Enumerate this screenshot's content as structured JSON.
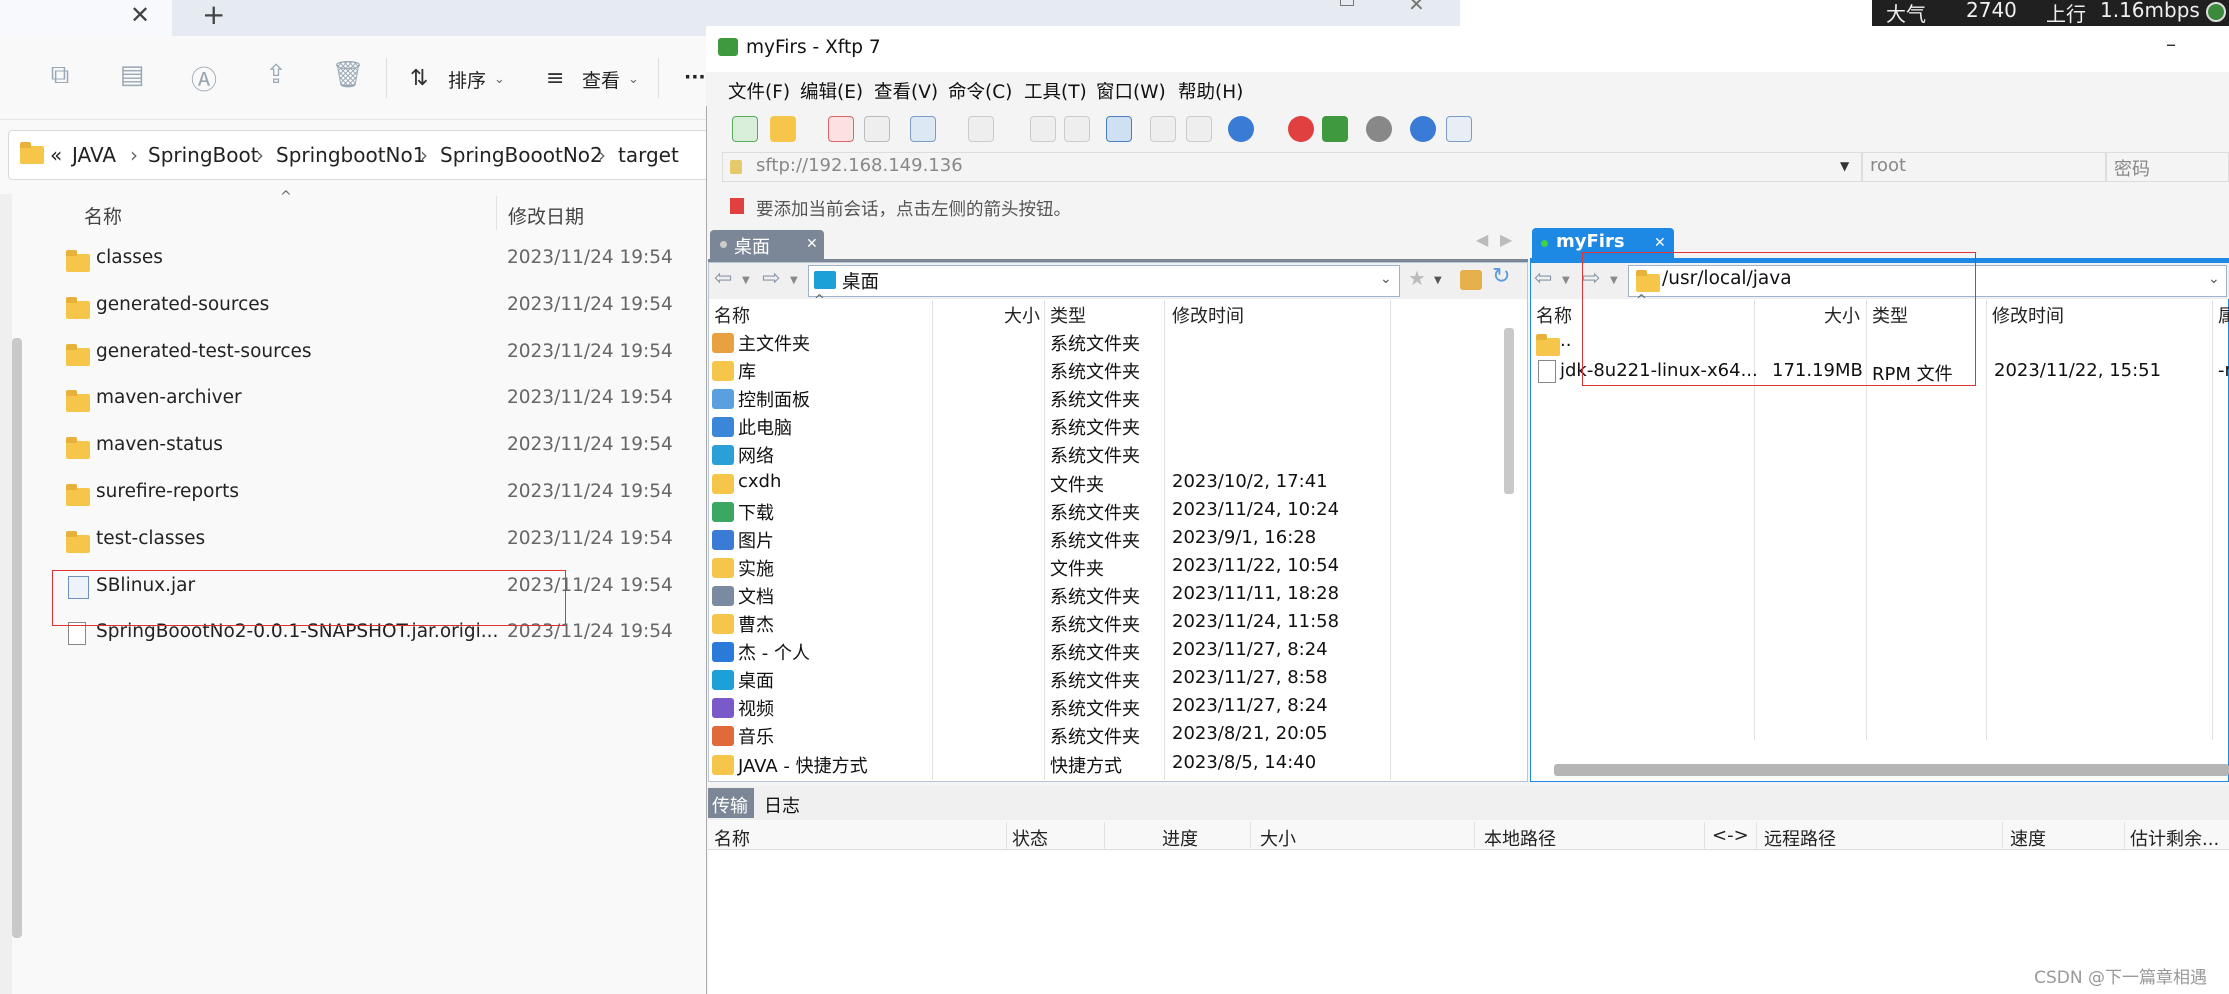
{
  "explorer": {
    "address_prefix": "«",
    "breadcrumbs": [
      "JAVA",
      "SpringBoot",
      "SpringbootNo1",
      "SpringBoootNo2",
      "target"
    ],
    "toolbar": {
      "sort_label": "排序",
      "view_label": "查看",
      "more_label": "···"
    },
    "columns": {
      "name": "名称",
      "modified": "修改日期"
    },
    "files": [
      {
        "name": "classes",
        "date": "2023/11/24 19:54",
        "icon": "folder-icon"
      },
      {
        "name": "generated-sources",
        "date": "2023/11/24 19:54",
        "icon": "folder-icon"
      },
      {
        "name": "generated-test-sources",
        "date": "2023/11/24 19:54",
        "icon": "folder-icon"
      },
      {
        "name": "maven-archiver",
        "date": "2023/11/24 19:54",
        "icon": "folder-icon"
      },
      {
        "name": "maven-status",
        "date": "2023/11/24 19:54",
        "icon": "folder-icon"
      },
      {
        "name": "surefire-reports",
        "date": "2023/11/24 19:54",
        "icon": "folder-icon"
      },
      {
        "name": "test-classes",
        "date": "2023/11/24 19:54",
        "icon": "folder-icon"
      },
      {
        "name": "SBlinux.jar",
        "date": "2023/11/24 19:54",
        "icon": "jar-icon"
      },
      {
        "name": "SpringBoootNo2-0.0.1-SNAPSHOT.jar.origi...",
        "date": "2023/11/24 19:54",
        "icon": "file-icon"
      }
    ]
  },
  "tray": {
    "weather": "大气",
    "value": "2740",
    "upload_label": "上行",
    "speed": "1.16mbps"
  },
  "xftp": {
    "title": "myFirs - Xftp 7",
    "menu": [
      "文件(F)",
      "编辑(E)",
      "查看(V)",
      "命令(C)",
      "工具(T)",
      "窗口(W)",
      "帮助(H)"
    ],
    "address": "sftp://192.168.149.136",
    "user_placeholder": "root",
    "password_placeholder": "密码",
    "hint": "要添加当前会话，点击左侧的箭头按钮。",
    "local": {
      "tab": "桌面",
      "path": "桌面",
      "columns": [
        "名称",
        "大小",
        "类型",
        "修改时间"
      ],
      "rows": [
        {
          "name": "主文件夹",
          "type": "系统文件夹",
          "time": ""
        },
        {
          "name": "库",
          "type": "系统文件夹",
          "time": ""
        },
        {
          "name": "控制面板",
          "type": "系统文件夹",
          "time": ""
        },
        {
          "name": "此电脑",
          "type": "系统文件夹",
          "time": ""
        },
        {
          "name": "网络",
          "type": "系统文件夹",
          "time": ""
        },
        {
          "name": "cxdh",
          "type": "文件夹",
          "time": "2023/10/2, 17:41"
        },
        {
          "name": "下载",
          "type": "系统文件夹",
          "time": "2023/11/24, 10:24"
        },
        {
          "name": "图片",
          "type": "系统文件夹",
          "time": "2023/9/1, 16:28"
        },
        {
          "name": "实施",
          "type": "文件夹",
          "time": "2023/11/22, 10:54"
        },
        {
          "name": "文档",
          "type": "系统文件夹",
          "time": "2023/11/11, 18:28"
        },
        {
          "name": "曹杰",
          "type": "系统文件夹",
          "time": "2023/11/24, 11:58"
        },
        {
          "name": "杰 - 个人",
          "type": "系统文件夹",
          "time": "2023/11/27, 8:24"
        },
        {
          "name": "桌面",
          "type": "系统文件夹",
          "time": "2023/11/27, 8:58"
        },
        {
          "name": "视频",
          "type": "系统文件夹",
          "time": "2023/11/27, 8:24"
        },
        {
          "name": "音乐",
          "type": "系统文件夹",
          "time": "2023/8/21, 20:05"
        },
        {
          "name": "JAVA - 快捷方式",
          "type": "快捷方式",
          "time": "2023/8/5, 14:40"
        }
      ]
    },
    "remote": {
      "tab": "myFirs",
      "path": "/usr/local/java",
      "columns": [
        "名称",
        "大小",
        "类型",
        "修改时间",
        "属"
      ],
      "up_label": "..",
      "rows": [
        {
          "name": "jdk-8u221-linux-x64...",
          "size": "171.19MB",
          "type": "RPM 文件",
          "time": "2023/11/22, 15:51",
          "extra": "-r"
        }
      ]
    },
    "bottom_tabs": [
      "传输",
      "日志"
    ],
    "transfer_columns": [
      "名称",
      "状态",
      "进度",
      "大小",
      "本地路径",
      "<->",
      "远程路径",
      "速度",
      "估计剩余..."
    ]
  },
  "watermark": "CSDN @下一篇章相遇"
}
